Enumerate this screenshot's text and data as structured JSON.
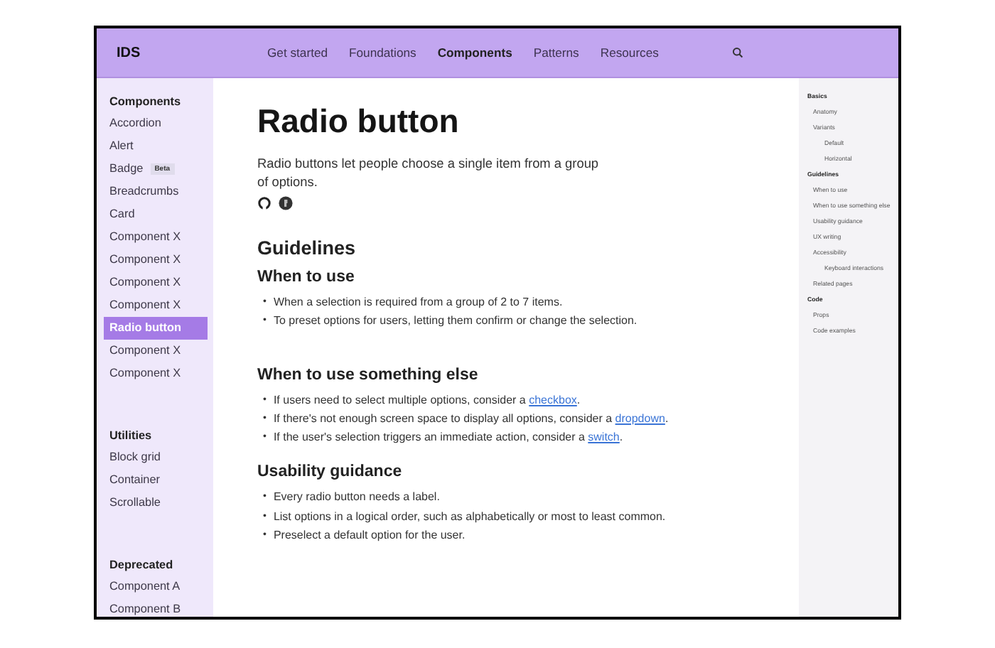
{
  "header": {
    "logo": "IDS",
    "nav": [
      {
        "label": "Get started",
        "selected": false
      },
      {
        "label": "Foundations",
        "selected": false
      },
      {
        "label": "Components",
        "selected": true
      },
      {
        "label": "Patterns",
        "selected": false
      },
      {
        "label": "Resources",
        "selected": false
      }
    ]
  },
  "sidebar": {
    "groups": [
      {
        "title": "Components",
        "items": [
          {
            "label": "Accordion",
            "selected": false
          },
          {
            "label": "Alert",
            "selected": false
          },
          {
            "label": "Badge",
            "badge": "Beta",
            "selected": false
          },
          {
            "label": "Breadcrumbs",
            "selected": false
          },
          {
            "label": "Card",
            "selected": false
          },
          {
            "label": "Component X",
            "selected": false
          },
          {
            "label": "Component X",
            "selected": false
          },
          {
            "label": "Component X",
            "selected": false
          },
          {
            "label": "Component X",
            "selected": false
          },
          {
            "label": "Radio button",
            "selected": true
          },
          {
            "label": "Component X",
            "selected": false
          },
          {
            "label": "Component X",
            "selected": false
          }
        ]
      },
      {
        "title": "Utilities",
        "items": [
          {
            "label": "Block grid",
            "selected": false
          },
          {
            "label": "Container",
            "selected": false
          },
          {
            "label": "Scrollable",
            "selected": false
          }
        ]
      },
      {
        "title": "Deprecated",
        "items": [
          {
            "label": "Component A",
            "selected": false
          },
          {
            "label": "Component B",
            "selected": false
          }
        ]
      }
    ]
  },
  "main": {
    "marker": "•",
    "title": "Radio button",
    "intro": "Radio buttons let people choose a single item from a group of options.",
    "section": "Guidelines",
    "subsections": [
      {
        "title": "When to use",
        "bullets": [
          {
            "text": "When a selection is required from a group of 2 to 7 items."
          },
          {
            "text": "To preset options for users, letting them confirm or change the selection."
          }
        ]
      },
      {
        "title": "When to use something else",
        "bullets": [
          {
            "text": "If users need to select multiple options, consider a ",
            "link": "checkbox",
            "after": "."
          },
          {
            "text": "If there's not enough screen space to display all options, consider a ",
            "link": "dropdown",
            "after": "."
          },
          {
            "text": "If the user's selection triggers an immediate action, consider a ",
            "link": "switch",
            "after": "."
          }
        ]
      },
      {
        "title": "Usability guidance",
        "bullets": [
          {
            "text": "Every radio button needs a label."
          },
          {
            "text": "List options in a logical order, such as alphabetically or most to least common."
          },
          {
            "text": "Preselect a default option for the user."
          }
        ]
      }
    ]
  },
  "toc": [
    {
      "label": "Basics",
      "children": [
        {
          "label": "Anatomy"
        },
        {
          "label": "Variants",
          "children": [
            {
              "label": "Default"
            },
            {
              "label": "Horizontal"
            }
          ]
        }
      ]
    },
    {
      "label": "Guidelines",
      "children": [
        {
          "label": "When to use"
        },
        {
          "label": "When to use something else"
        },
        {
          "label": "Usability guidance"
        },
        {
          "label": "UX writing"
        },
        {
          "label": "Accessibility",
          "children": [
            {
              "label": "Keyboard interactions"
            }
          ]
        },
        {
          "label": "Related pages"
        }
      ]
    },
    {
      "label": "Code",
      "children": [
        {
          "label": "Props"
        },
        {
          "label": "Code examples"
        }
      ]
    }
  ]
}
